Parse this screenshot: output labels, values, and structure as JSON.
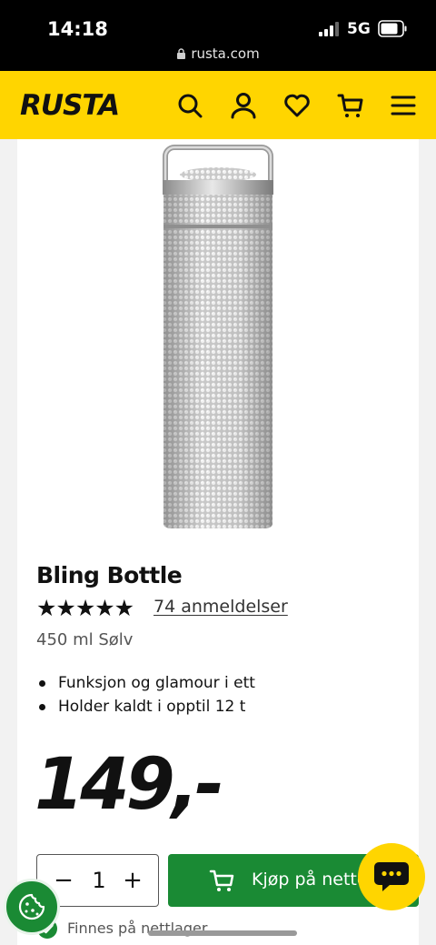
{
  "status_bar": {
    "time": "14:18",
    "network": "5G"
  },
  "browser": {
    "url": "rusta.com"
  },
  "header": {
    "logo_text": "RUSTA",
    "icons": [
      "search-icon",
      "account-icon",
      "wishlist-icon",
      "cart-icon",
      "menu-icon"
    ]
  },
  "product": {
    "title": "Bling Bottle",
    "rating_stars": "★★★★★",
    "rating_value": 5,
    "reviews_label": "74 anmeldelser",
    "variant": "450 ml Sølv",
    "features": [
      "Funksjon og glamour i ett",
      "Holder kaldt i opptil 12 t"
    ],
    "price": "149,-"
  },
  "purchase": {
    "minus_label": "−",
    "quantity": "1",
    "plus_label": "+",
    "buy_label": "Kjøp på nettet",
    "stock_text": "Finnes på nettlager"
  },
  "colors": {
    "brand_yellow": "#ffd500",
    "buy_green": "#1a8a34"
  }
}
